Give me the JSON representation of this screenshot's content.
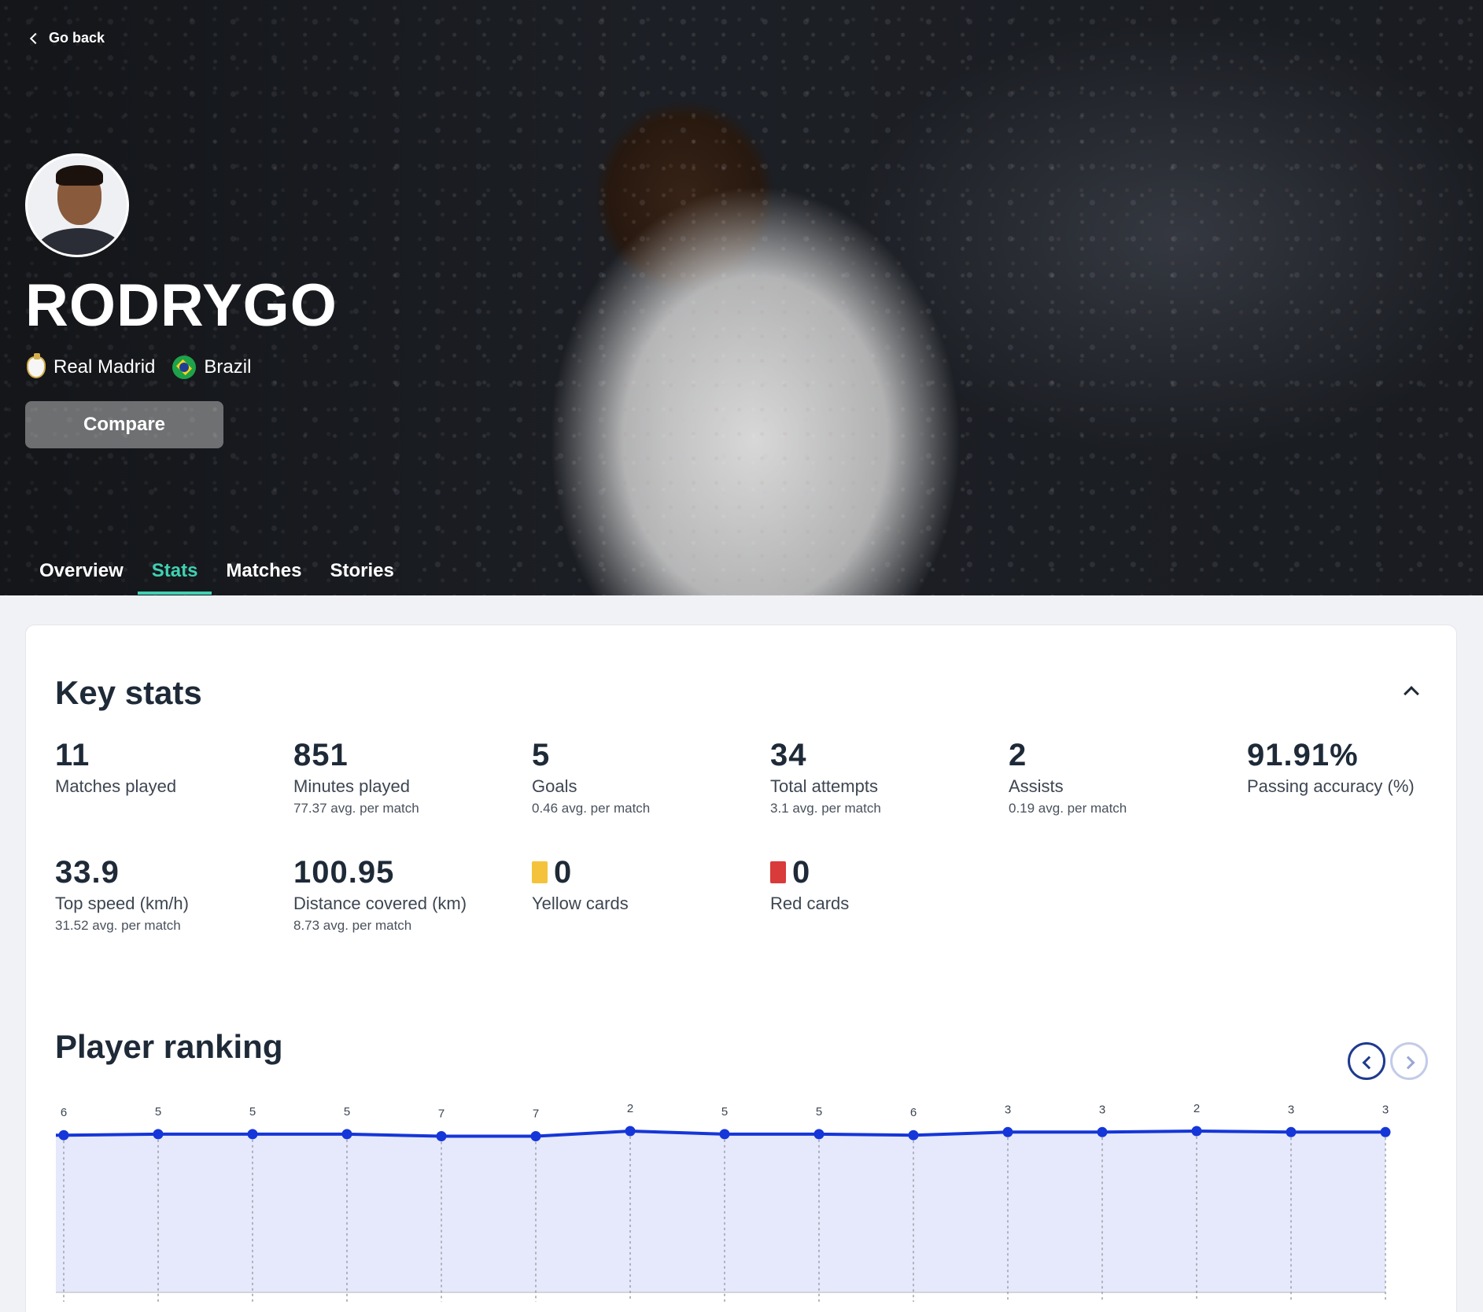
{
  "nav": {
    "go_back": "Go back"
  },
  "player": {
    "name": "RODRYGO",
    "club": "Real Madrid",
    "country": "Brazil",
    "compare_label": "Compare"
  },
  "tabs": [
    {
      "label": "Overview",
      "active": false
    },
    {
      "label": "Stats",
      "active": true
    },
    {
      "label": "Matches",
      "active": false
    },
    {
      "label": "Stories",
      "active": false
    }
  ],
  "key_stats": {
    "title": "Key stats",
    "items": [
      {
        "value": "11",
        "label": "Matches played",
        "sub": ""
      },
      {
        "value": "851",
        "label": "Minutes played",
        "sub": "77.37 avg. per match"
      },
      {
        "value": "5",
        "label": "Goals",
        "sub": "0.46 avg. per match"
      },
      {
        "value": "34",
        "label": "Total attempts",
        "sub": "3.1 avg. per match"
      },
      {
        "value": "2",
        "label": "Assists",
        "sub": "0.19 avg. per match"
      },
      {
        "value": "91.91%",
        "label": "Passing accuracy (%)",
        "sub": ""
      },
      {
        "value": "33.9",
        "label": "Top speed (km/h)",
        "sub": "31.52 avg. per match"
      },
      {
        "value": "100.95",
        "label": "Distance covered (km)",
        "sub": "8.73 avg. per match"
      },
      {
        "value": "0",
        "label": "Yellow cards",
        "sub": "",
        "icon": "yellow-card-icon",
        "icon_color": "#f5c33b"
      },
      {
        "value": "0",
        "label": "Red cards",
        "sub": "",
        "icon": "red-card-icon",
        "icon_color": "#d93a3a"
      }
    ]
  },
  "ranking": {
    "title": "Player ranking",
    "prev_icon": "chevron-left-icon",
    "next_icon": "chevron-right-icon"
  },
  "chart_data": {
    "type": "area",
    "title": "Player ranking",
    "values": [
      6,
      5,
      5,
      5,
      7,
      7,
      2,
      5,
      5,
      6,
      3,
      3,
      2,
      3,
      3
    ],
    "y_inverted": true,
    "line_color": "#1536d8",
    "fill_color": "#e6e9fb"
  }
}
